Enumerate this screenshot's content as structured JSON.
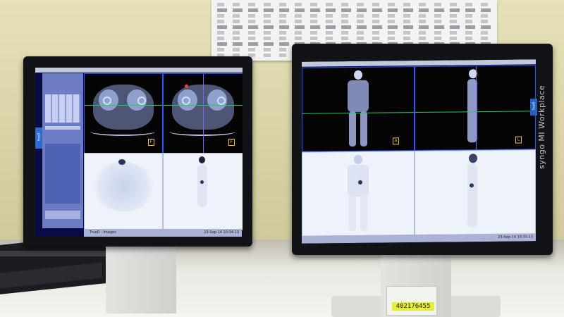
{
  "left_monitor": {
    "screen_label": "TrueD",
    "status_left": "TrueD - Images",
    "datetime": "23-Sep-14 10:34:13",
    "pane_markers": [
      "F",
      "F"
    ]
  },
  "right_monitor": {
    "brand": "syngo MI Workplace",
    "side_tab": "TrueD",
    "datetime": "23-Sep-14 10:35:13",
    "pane_markers": [
      "A",
      "L"
    ]
  },
  "sticker": {
    "serial": "402176455"
  }
}
